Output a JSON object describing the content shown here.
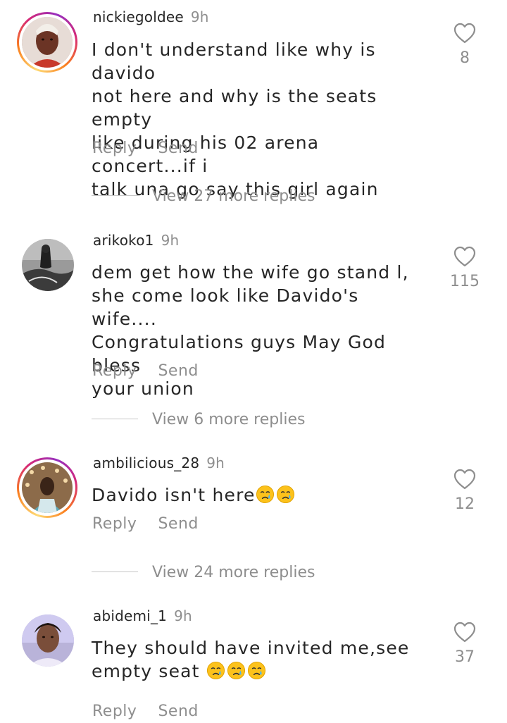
{
  "comments": [
    {
      "username": "nickiegoldee",
      "time": "9h",
      "lines": [
        "I don't understand like why is davido",
        "not here and why is the seats empty",
        "like during his 02 arena concert...if i",
        "talk una go say this girl again"
      ],
      "reply_label": "Reply",
      "send_label": "Send",
      "likes": "8",
      "view_replies": "View 27 more replies"
    },
    {
      "username": "arikoko1",
      "time": "9h",
      "lines": [
        "dem get how the wife go stand l,",
        "she come look like Davido's wife....",
        "Congratulations guys May God bless",
        "your union"
      ],
      "reply_label": "Reply",
      "send_label": "Send",
      "likes": "115",
      "view_replies": "View 6 more replies"
    },
    {
      "username": "ambilicious_28",
      "time": "9h",
      "text": "Davido isn't here",
      "emoji_count": 2,
      "reply_label": "Reply",
      "send_label": "Send",
      "likes": "12",
      "view_replies": "View 24 more replies"
    },
    {
      "username": "abidemi_1",
      "time": "9h",
      "line1": "They should have invited me,see",
      "line2": "empty seat ",
      "emoji_count": 3,
      "reply_label": "Reply",
      "send_label": "Send",
      "likes": "37"
    }
  ],
  "icons": {
    "like": "heart-outline-icon",
    "emoji": "crying-face-emoji"
  },
  "colors": {
    "text": "#262626",
    "secondary": "#8e8e8e",
    "story_ring": "#d62976"
  }
}
